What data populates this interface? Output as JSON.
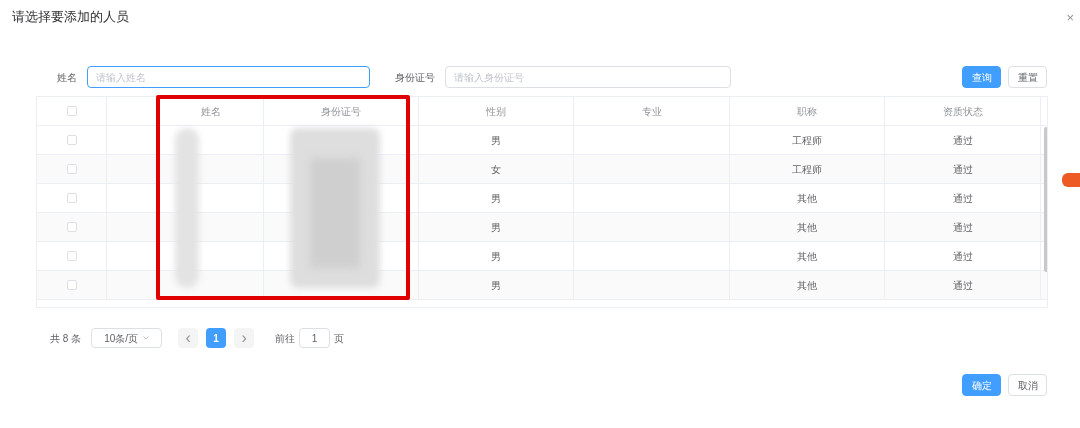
{
  "dialog": {
    "title": "请选择要添加的人员",
    "close": "×"
  },
  "filters": [
    {
      "label": "姓名",
      "placeholder": "请输入姓名"
    },
    {
      "label": "身份证号",
      "placeholder": "请输入身份证号"
    }
  ],
  "filter_buttons": [
    {
      "kind": "primary",
      "label": "查询"
    },
    {
      "kind": "plain",
      "label": "重置"
    }
  ],
  "table": {
    "select_all_checked": false,
    "columns": [
      "姓名",
      "身份证号",
      "性别",
      "专业",
      "职称",
      "资质状态"
    ],
    "rows": [
      {
        "checked": false,
        "gender": "男",
        "title": "工程师",
        "status": "通过"
      },
      {
        "checked": false,
        "gender": "女",
        "title": "工程师",
        "status": "通过"
      },
      {
        "checked": false,
        "gender": "男",
        "title": "其他",
        "status": "通过"
      },
      {
        "checked": false,
        "gender": "男",
        "title": "其他",
        "status": "通过"
      },
      {
        "checked": false,
        "gender": "男",
        "title": "其他",
        "status": "通过"
      },
      {
        "checked": false,
        "gender": "男",
        "title": "其他",
        "status": "通过"
      }
    ]
  },
  "pagination": {
    "total": "共 8 条",
    "page_size": "10条/页",
    "prev": "‹",
    "pages": [
      {
        "label": "1",
        "selected": true
      }
    ],
    "next": "›",
    "goto_label": "前往",
    "goto_value": "1",
    "goto_suffix": "页"
  },
  "footer_buttons": [
    {
      "kind": "primary",
      "label": "确定"
    },
    {
      "kind": "plain",
      "label": "取消"
    }
  ]
}
